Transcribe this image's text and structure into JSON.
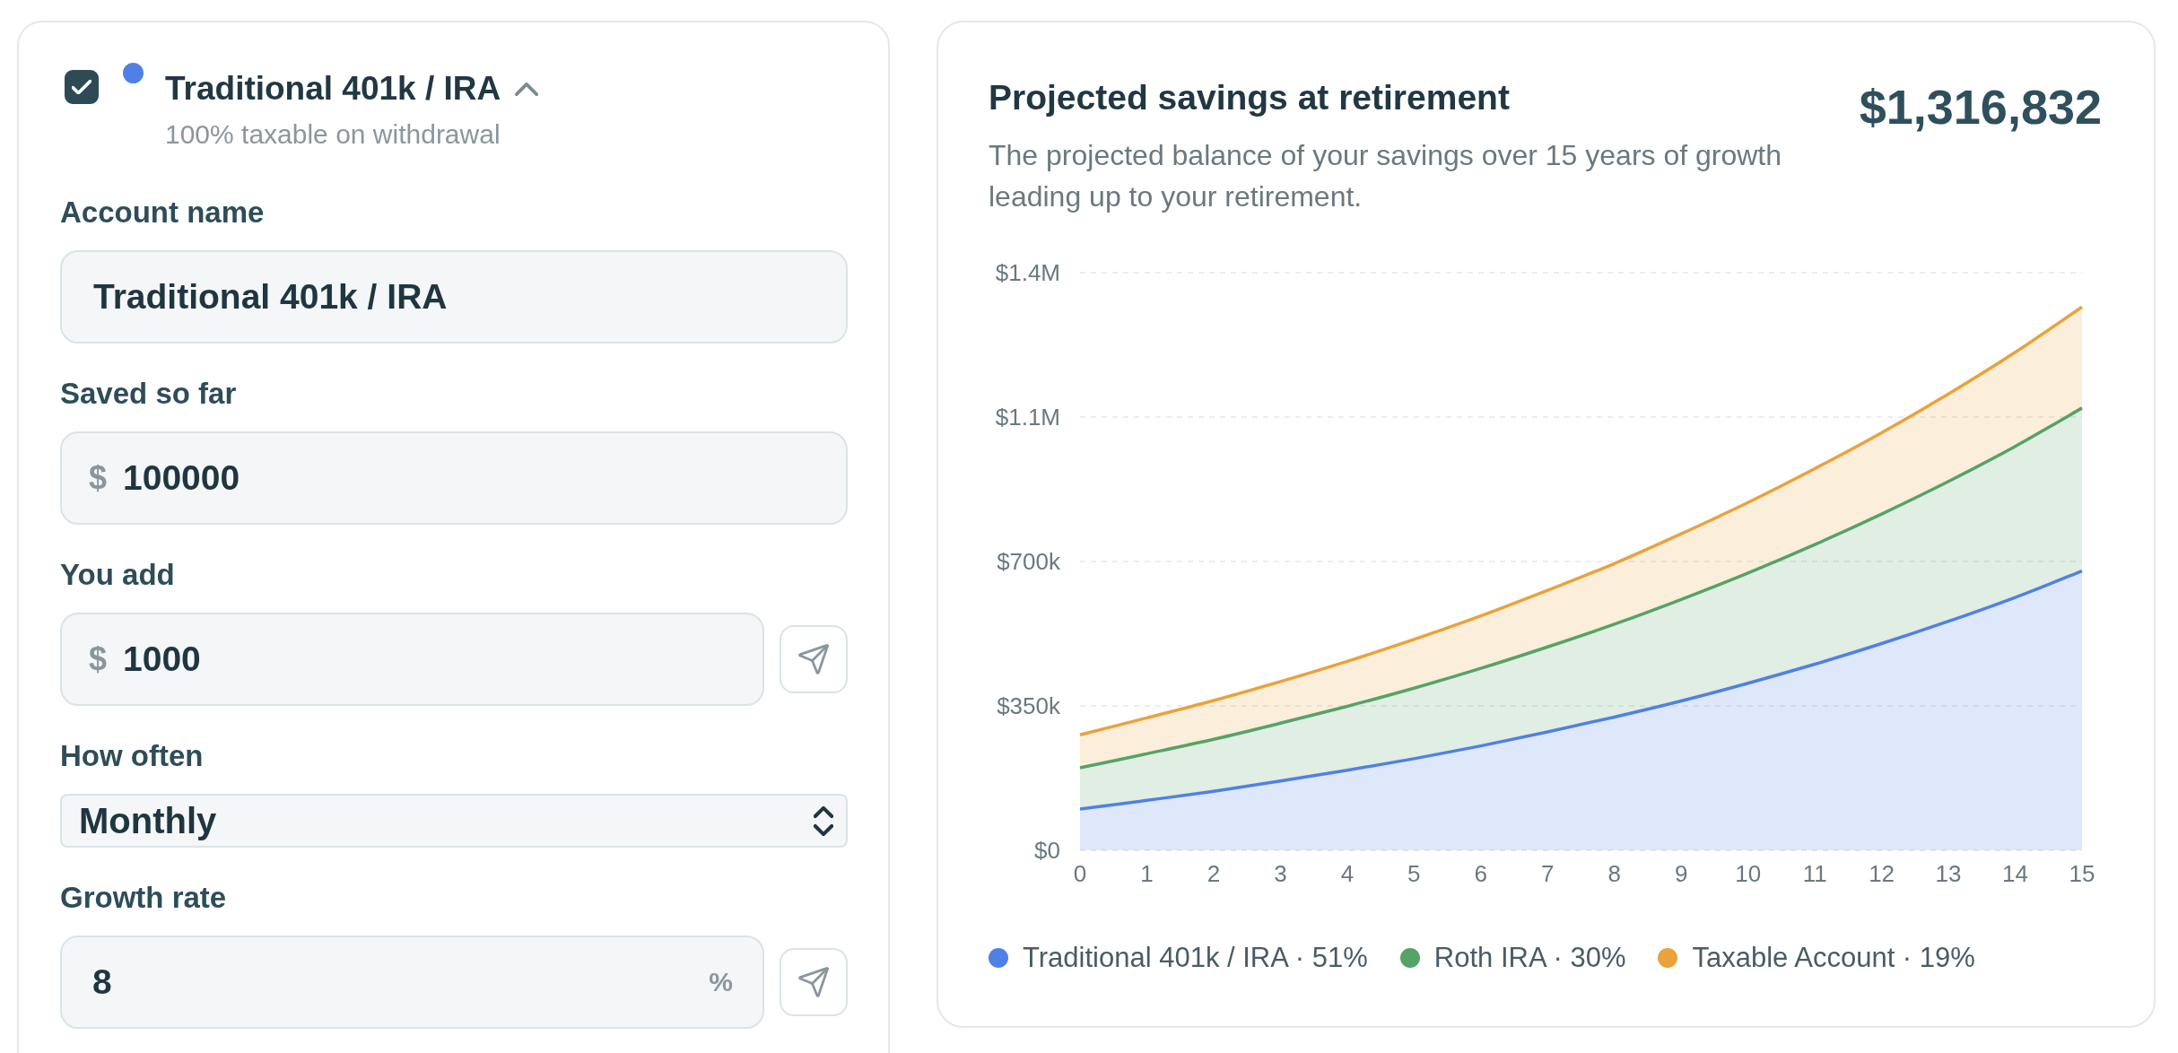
{
  "account": {
    "checked": true,
    "color": "#4f80e8",
    "title": "Traditional 401k / IRA",
    "expanded": true,
    "subtitle": "100% taxable on withdrawal",
    "fields": [
      {
        "kind": "text",
        "label": "Account name",
        "value": "Traditional 401k / IRA",
        "action": false
      },
      {
        "kind": "amount",
        "label": "Saved so far",
        "prefix": "$",
        "value": "100000",
        "action": false
      },
      {
        "kind": "amount",
        "label": "You add",
        "prefix": "$",
        "value": "1000",
        "action": true
      },
      {
        "kind": "select",
        "label": "How often",
        "value": "Monthly",
        "action": false
      },
      {
        "kind": "rate",
        "label": "Growth rate",
        "value": "8",
        "suffix": "%",
        "action": true
      }
    ]
  },
  "projection": {
    "title": "Projected savings at retirement",
    "total": "$1,316,832",
    "description": "The projected balance of your savings over 15 years of growth leading up to your retirement.",
    "chart_data": {
      "type": "area",
      "stacked": true,
      "grid": true,
      "x": [
        0,
        1,
        2,
        3,
        4,
        5,
        6,
        7,
        8,
        9,
        10,
        11,
        12,
        13,
        14,
        15
      ],
      "xlim": [
        0,
        15
      ],
      "series": [
        {
          "name": "Traditional 401k / IRA · 51%",
          "color": "#4f80e8",
          "values": [
            100000,
            121000,
            143000,
            168000,
            194000,
            222000,
            253000,
            287000,
            323000,
            362000,
            405000,
            451000,
            501000,
            555000,
            613000,
            677000
          ]
        },
        {
          "name": "Roth IRA · 30%",
          "color": "#55a366",
          "values": [
            100000,
            113000,
            126000,
            140000,
            155000,
            171000,
            188000,
            206000,
            225000,
            246000,
            267000,
            290000,
            314000,
            339000,
            366000,
            395000
          ]
        },
        {
          "name": "Taxable Account · 19%",
          "color": "#eaa23a",
          "values": [
            80000,
            87000,
            94000,
            101000,
            109000,
            118000,
            127000,
            137000,
            147000,
            159000,
            171000,
            184000,
            197000,
            212000,
            228000,
            245000
          ]
        }
      ],
      "ylim": [
        0,
        1400000
      ],
      "yticks": [
        {
          "value": 0,
          "label": "$0"
        },
        {
          "value": 350000,
          "label": "$350k"
        },
        {
          "value": 700000,
          "label": "$700k"
        },
        {
          "value": 1050000,
          "label": "$1.1M"
        },
        {
          "value": 1400000,
          "label": "$1.4M"
        }
      ],
      "xticks": [
        0,
        1,
        2,
        3,
        4,
        5,
        6,
        7,
        8,
        9,
        10,
        11,
        12,
        13,
        14,
        15
      ]
    }
  }
}
